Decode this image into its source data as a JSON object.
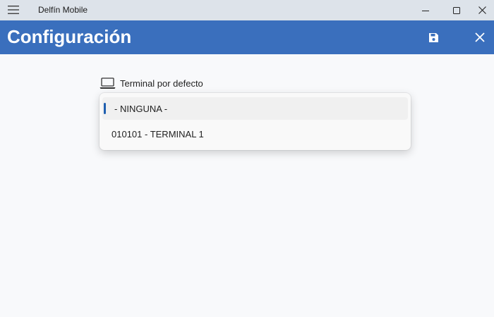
{
  "window": {
    "app_title": "Delfín Mobile"
  },
  "header": {
    "title": "Configuración"
  },
  "field": {
    "label": "Terminal por defecto",
    "options": [
      {
        "label": "- NINGUNA -",
        "selected": true
      },
      {
        "label": "010101 - TERMINAL 1",
        "selected": false
      }
    ]
  },
  "colors": {
    "accent": "#3a6fbd",
    "titlebar": "#dde3ea",
    "background": "#f8f9fb",
    "selection_indicator": "#1f5fb0"
  },
  "icons": {
    "menu": "hamburger-icon",
    "minimize": "minimize-icon",
    "maximize": "maximize-icon",
    "close_window": "close-icon",
    "save": "save-icon",
    "close_page": "close-icon",
    "field": "laptop-icon"
  }
}
